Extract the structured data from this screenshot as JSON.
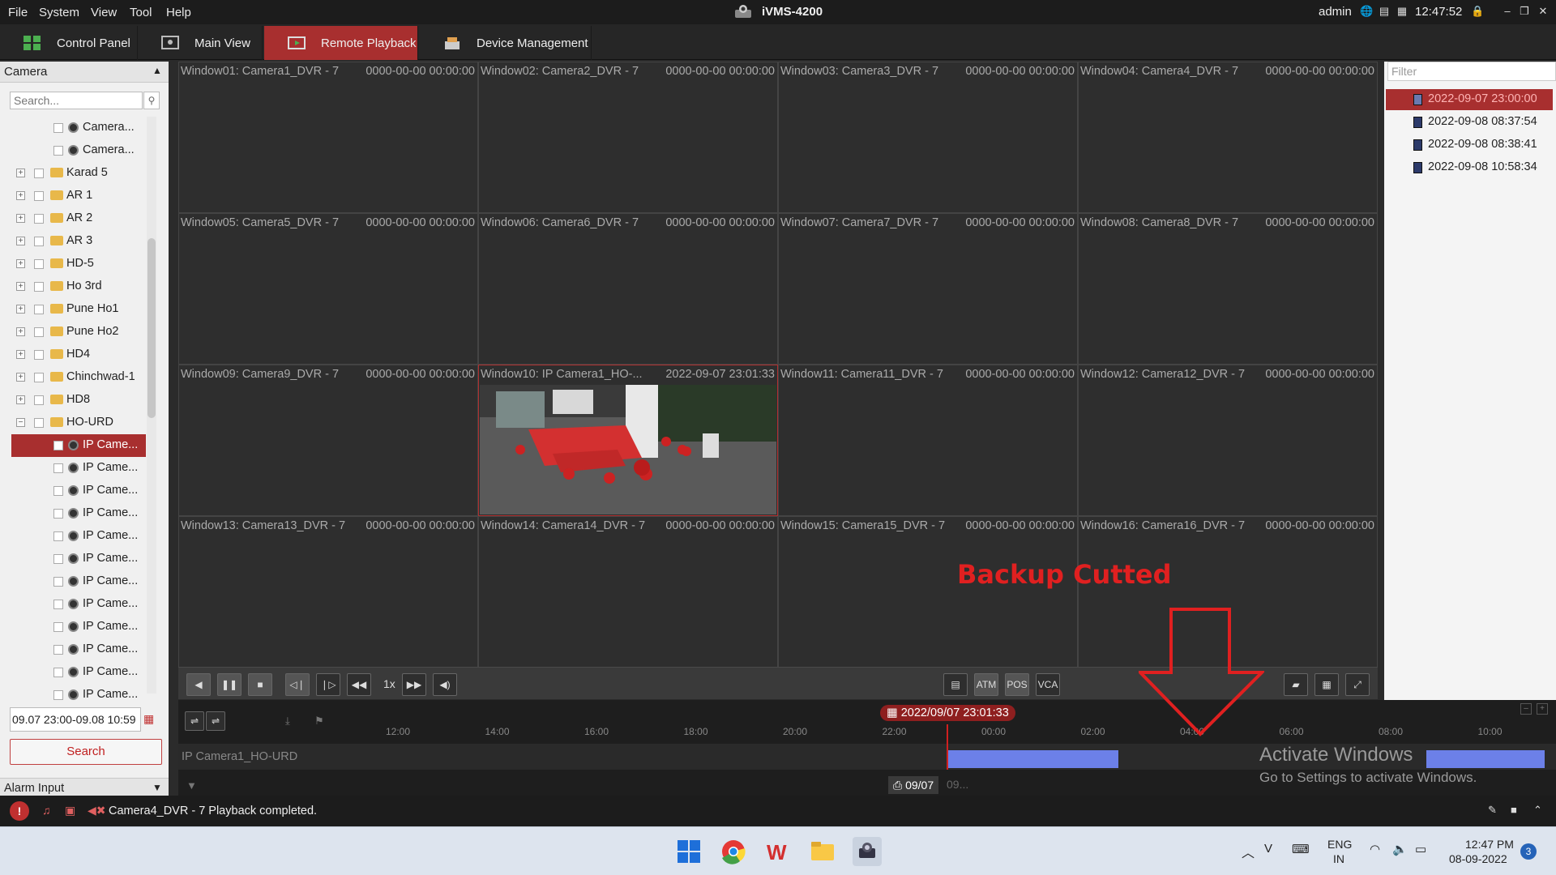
{
  "menubar": {
    "items": [
      "File",
      "System",
      "View",
      "Tool",
      "Help"
    ],
    "app_title": "iVMS-4200",
    "user": "admin",
    "clock": "12:47:52"
  },
  "tabs": [
    {
      "label": "Control Panel",
      "active": false
    },
    {
      "label": "Main View",
      "active": false
    },
    {
      "label": "Remote Playback",
      "active": true
    },
    {
      "label": "Device Management",
      "active": false
    }
  ],
  "left_panel": {
    "header": "Camera",
    "search_placeholder": "Search...",
    "tree": [
      {
        "label": "Camera...",
        "type": "camera"
      },
      {
        "label": "Camera...",
        "type": "camera"
      },
      {
        "label": "Karad 5",
        "type": "folder"
      },
      {
        "label": "AR 1",
        "type": "folder"
      },
      {
        "label": "AR 2",
        "type": "folder"
      },
      {
        "label": "AR 3",
        "type": "folder"
      },
      {
        "label": "HD-5",
        "type": "folder"
      },
      {
        "label": "Ho 3rd",
        "type": "folder"
      },
      {
        "label": "Pune Ho1",
        "type": "folder"
      },
      {
        "label": "Pune Ho2",
        "type": "folder"
      },
      {
        "label": "HD4",
        "type": "folder"
      },
      {
        "label": "Chinchwad-1",
        "type": "folder"
      },
      {
        "label": "HD8",
        "type": "folder"
      },
      {
        "label": "HO-URD",
        "type": "folder-open"
      },
      {
        "label": "IP Came...",
        "type": "camera",
        "selected": true
      },
      {
        "label": "IP Came...",
        "type": "camera"
      },
      {
        "label": "IP Came...",
        "type": "camera"
      },
      {
        "label": "IP Came...",
        "type": "camera"
      },
      {
        "label": "IP Came...",
        "type": "camera"
      },
      {
        "label": "IP Came...",
        "type": "camera"
      },
      {
        "label": "IP Came...",
        "type": "camera"
      },
      {
        "label": "IP Came...",
        "type": "camera"
      },
      {
        "label": "IP Came...",
        "type": "camera"
      },
      {
        "label": "IP Came...",
        "type": "camera"
      },
      {
        "label": "IP Came...",
        "type": "camera"
      },
      {
        "label": "IP Came...",
        "type": "camera"
      }
    ],
    "date_range": "09.07 23:00-09.08 10:59",
    "search_button": "Search",
    "alarm_header": "Alarm Input"
  },
  "grid": [
    {
      "title": "Window01:  Camera1_DVR - 7",
      "time": "0000-00-00 00:00:00"
    },
    {
      "title": "Window02:  Camera2_DVR - 7",
      "time": "0000-00-00 00:00:00"
    },
    {
      "title": "Window03:  Camera3_DVR - 7",
      "time": "0000-00-00 00:00:00"
    },
    {
      "title": "Window04:  Camera4_DVR - 7",
      "time": "0000-00-00 00:00:00"
    },
    {
      "title": "Window05:  Camera5_DVR - 7",
      "time": "0000-00-00 00:00:00"
    },
    {
      "title": "Window06:  Camera6_DVR - 7",
      "time": "0000-00-00 00:00:00"
    },
    {
      "title": "Window07:  Camera7_DVR - 7",
      "time": "0000-00-00 00:00:00"
    },
    {
      "title": "Window08:  Camera8_DVR - 7",
      "time": "0000-00-00 00:00:00"
    },
    {
      "title": "Window09:  Camera9_DVR - 7",
      "time": "0000-00-00 00:00:00"
    },
    {
      "title": "Window10:  IP Camera1_HO-...",
      "time": "2022-09-07 23:01:33",
      "active": true
    },
    {
      "title": "Window11:  Camera11_DVR - 7",
      "time": "0000-00-00 00:00:00"
    },
    {
      "title": "Window12:  Camera12_DVR - 7",
      "time": "0000-00-00 00:00:00"
    },
    {
      "title": "Window13:  Camera13_DVR - 7",
      "time": "0000-00-00 00:00:00"
    },
    {
      "title": "Window14:  Camera14_DVR - 7",
      "time": "0000-00-00 00:00:00"
    },
    {
      "title": "Window15:  Camera15_DVR - 7",
      "time": "0000-00-00 00:00:00"
    },
    {
      "title": "Window16:  Camera16_DVR - 7",
      "time": "0000-00-00 00:00:00"
    }
  ],
  "right_panel": {
    "filter_placeholder": "Filter",
    "records": [
      {
        "label": "2022-09-07 23:00:00",
        "selected": true
      },
      {
        "label": "2022-09-08 08:37:54"
      },
      {
        "label": "2022-09-08 08:38:41"
      },
      {
        "label": "2022-09-08 10:58:34"
      }
    ]
  },
  "controls": {
    "speed": "1x"
  },
  "timeline": {
    "current_time": "2022/09/07 23:01:33",
    "ticks": [
      "12:00",
      "14:00",
      "16:00",
      "18:00",
      "20:00",
      "22:00",
      "00:00",
      "02:00",
      "04:00",
      "06:00",
      "08:00",
      "10:00"
    ],
    "track_label": "IP Camera1_HO-URD",
    "date_chip": "09/07",
    "date_chip_next": "09..."
  },
  "watermark": {
    "line1": "Activate Windows",
    "line2": "Go to Settings to activate Windows."
  },
  "status": {
    "message": "Camera4_DVR - 7 Playback completed."
  },
  "annotation": {
    "text": "Backup Cutted",
    "color": "#e02020"
  },
  "taskbar": {
    "lang1": "ENG",
    "lang2": "IN",
    "time": "12:47 PM",
    "date": "08-09-2022",
    "badge": "3"
  }
}
